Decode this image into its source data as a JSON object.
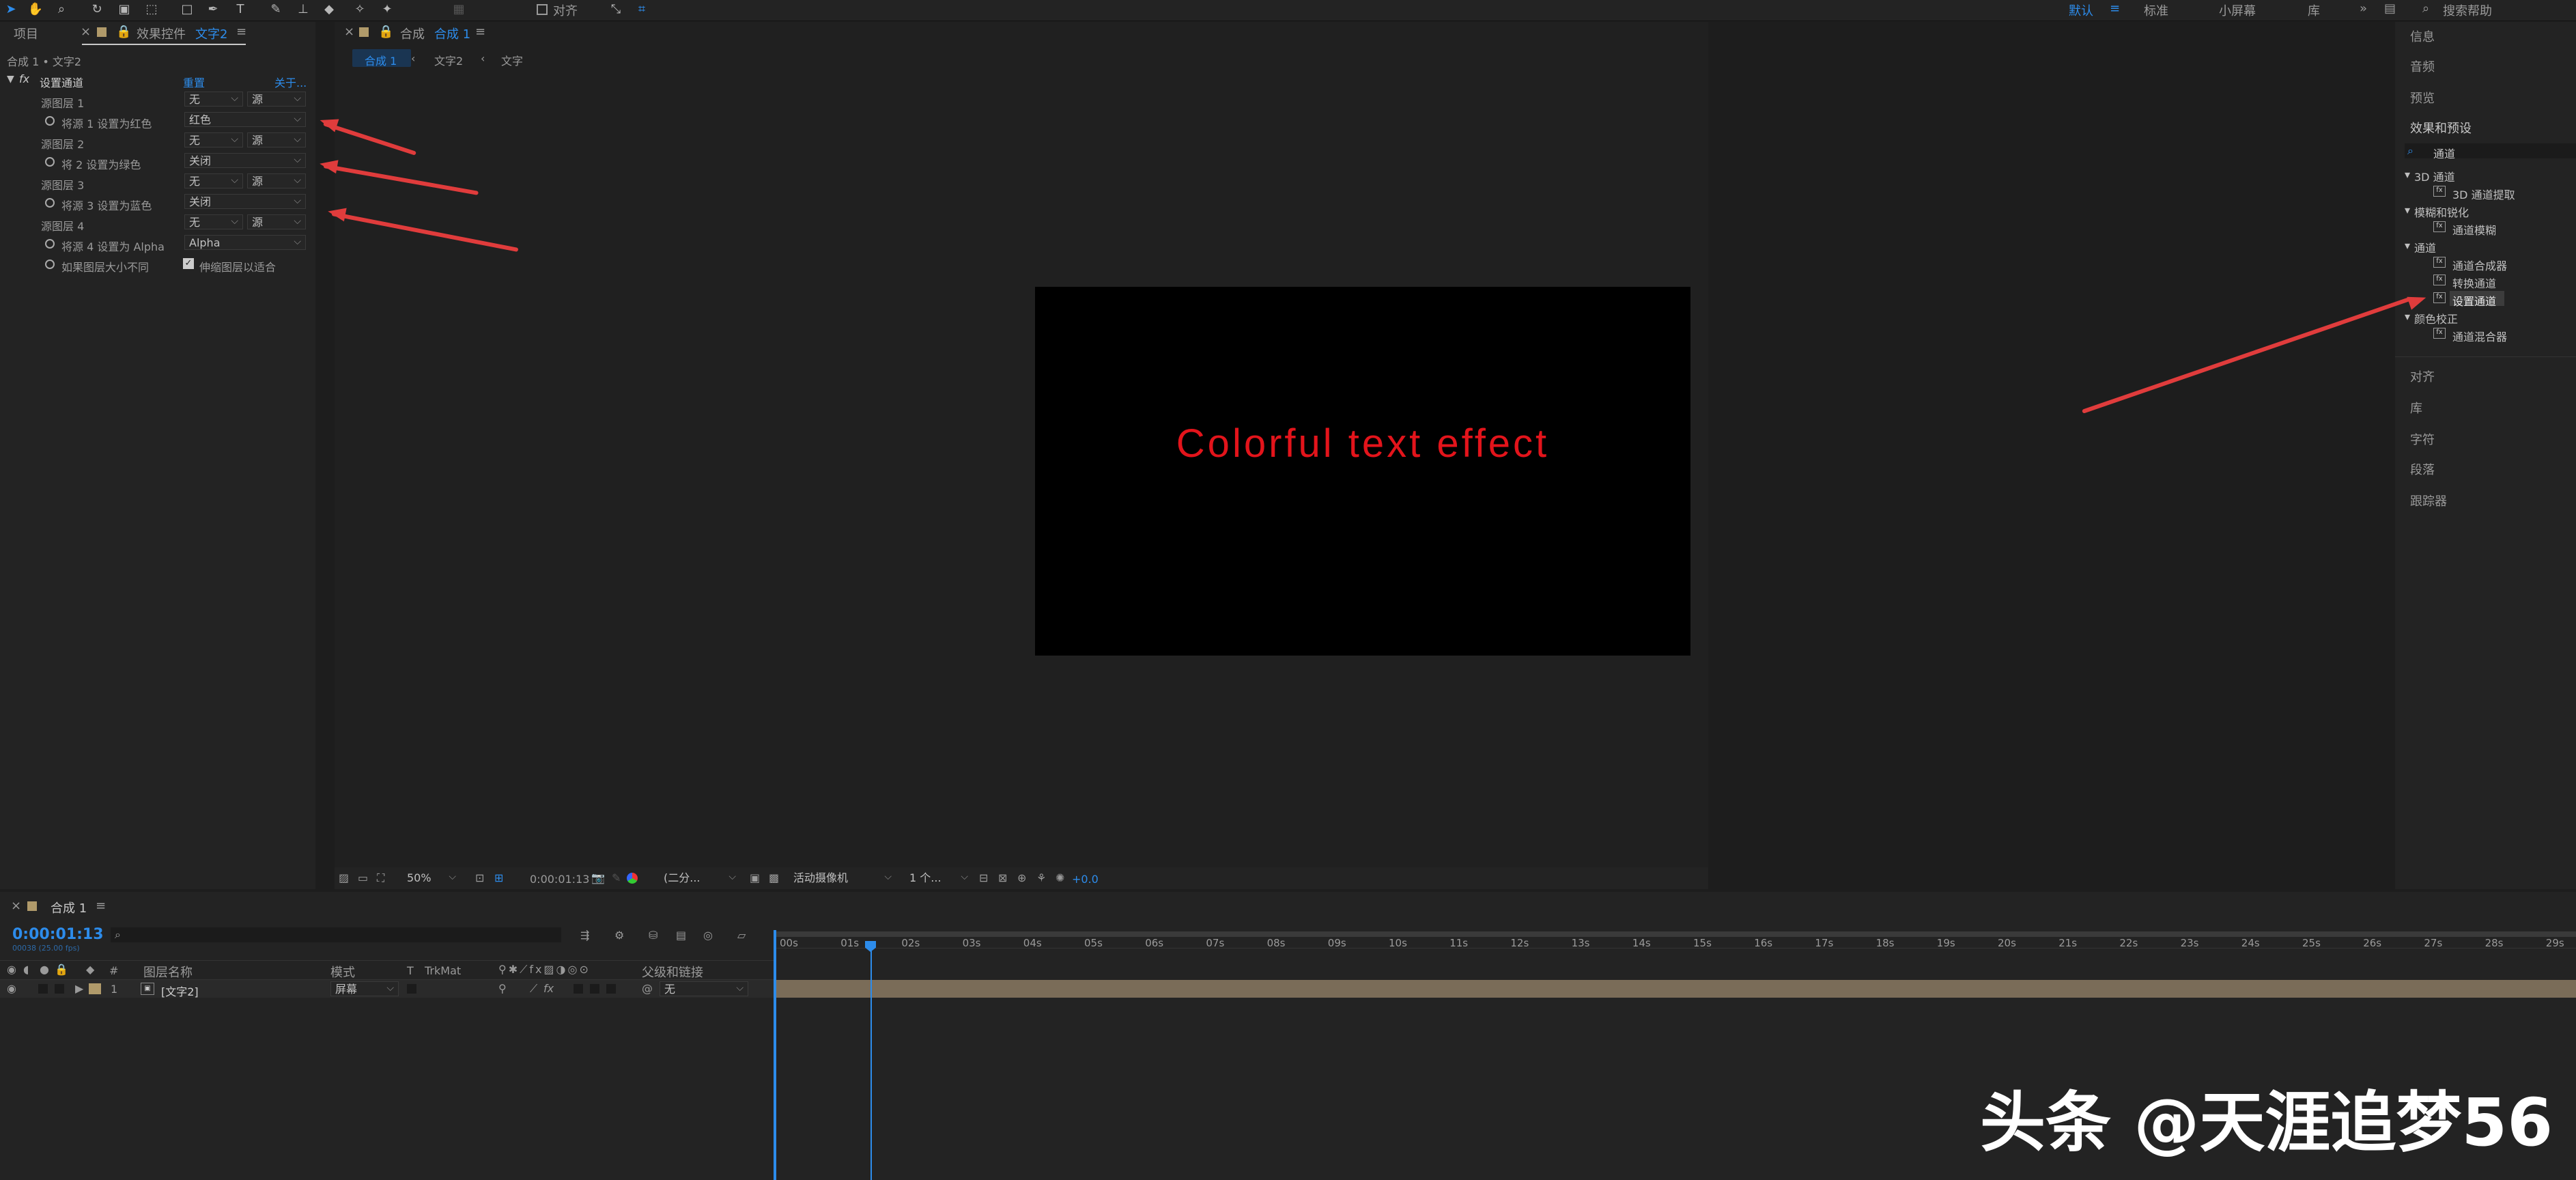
{
  "toolbar": {
    "align_label": "对齐",
    "workspaces": [
      "默认",
      "标准",
      "小屏幕",
      "库"
    ],
    "more": "»",
    "search_help": "搜索帮助",
    "tools": [
      "selection-tool",
      "hand-tool",
      "zoom-tool",
      "rotate-tool",
      "camera-tool",
      "pan-behind-tool",
      "rectangle-tool",
      "pen-tool",
      "type-tool",
      "brush-tool",
      "clone-stamp-tool",
      "eraser-tool",
      "roto-brush-tool",
      "puppet-tool"
    ]
  },
  "left_panel": {
    "tabs": [
      "项目",
      "效果控件",
      "文字2"
    ],
    "breadcrumb": "合成 1 • 文字2",
    "effect_name": "设置通道",
    "reset": "重置",
    "about": "关于...",
    "rows": [
      {
        "label": "源图层 1",
        "value": "无",
        "value2": "源"
      },
      {
        "label": "将源 1 设置为红色",
        "value": "红色"
      },
      {
        "label": "源图层 2",
        "value": "无",
        "value2": "源"
      },
      {
        "label": "将 2 设置为绿色",
        "value": "关闭"
      },
      {
        "label": "源图层 3",
        "value": "无",
        "value2": "源"
      },
      {
        "label": "将源 3 设置为蓝色",
        "value": "关闭"
      },
      {
        "label": "源图层 4",
        "value": "无",
        "value2": "源"
      },
      {
        "label": "将源 4 设置为 Alpha",
        "value": "Alpha"
      },
      {
        "label": "如果图层大小不同",
        "value": "伸缩图层以适合"
      }
    ]
  },
  "comp_panel": {
    "tab_prefix": "合成",
    "tab_name": "合成 1",
    "crumbs": [
      "合成 1",
      "文字2",
      "文字"
    ],
    "canvas_text": "Colorful text effect",
    "zoom": "50%",
    "timecode": "0:00:01:13",
    "resolution": "(二分...",
    "camera": "活动摄像机",
    "views": "1 个...",
    "exposure": "+0.0"
  },
  "right_panel": {
    "items": [
      "信息",
      "音频",
      "预览",
      "效果和预设"
    ],
    "search_placeholder": "通道",
    "tree": [
      {
        "type": "group",
        "label": "3D 通道"
      },
      {
        "type": "item",
        "label": "3D 通道提取"
      },
      {
        "type": "group",
        "label": "模糊和锐化"
      },
      {
        "type": "item",
        "label": "通道模糊"
      },
      {
        "type": "group",
        "label": "通道"
      },
      {
        "type": "item",
        "label": "通道合成器"
      },
      {
        "type": "item",
        "label": "转换通道"
      },
      {
        "type": "item",
        "label": "设置通道"
      },
      {
        "type": "group",
        "label": "颜色校正"
      },
      {
        "type": "item",
        "label": "通道混合器"
      }
    ],
    "bottom_items": [
      "对齐",
      "库",
      "字符",
      "段落",
      "跟踪器"
    ]
  },
  "timeline": {
    "tab": "合成 1",
    "timecode": "0:00:01:13",
    "sub_timecode": "00038 (25.00 fps)",
    "columns": {
      "num": "#",
      "layer_name": "图层名称",
      "mode": "模式",
      "t": "T",
      "trkmat": "TrkMat",
      "parent": "父级和链接"
    },
    "layer": {
      "index": "1",
      "name": "[文字2]",
      "mode": "屏幕",
      "parent": "无"
    },
    "ticks": [
      "00s",
      "01s",
      "02s",
      "03s",
      "04s",
      "05s",
      "06s",
      "07s",
      "08s",
      "09s",
      "10s",
      "11s",
      "12s",
      "13s",
      "14s",
      "15s",
      "16s",
      "17s",
      "18s",
      "19s",
      "20s",
      "21s",
      "22s",
      "23s",
      "24s",
      "25s",
      "26s",
      "27s",
      "28s",
      "29s"
    ]
  },
  "watermark": "头条 @天涯追梦56",
  "colors": {
    "accent": "#2d8ceb",
    "arrow": "#e03c3c",
    "canvas_text": "#e3141b",
    "layer_bar": "#7a6c58"
  }
}
